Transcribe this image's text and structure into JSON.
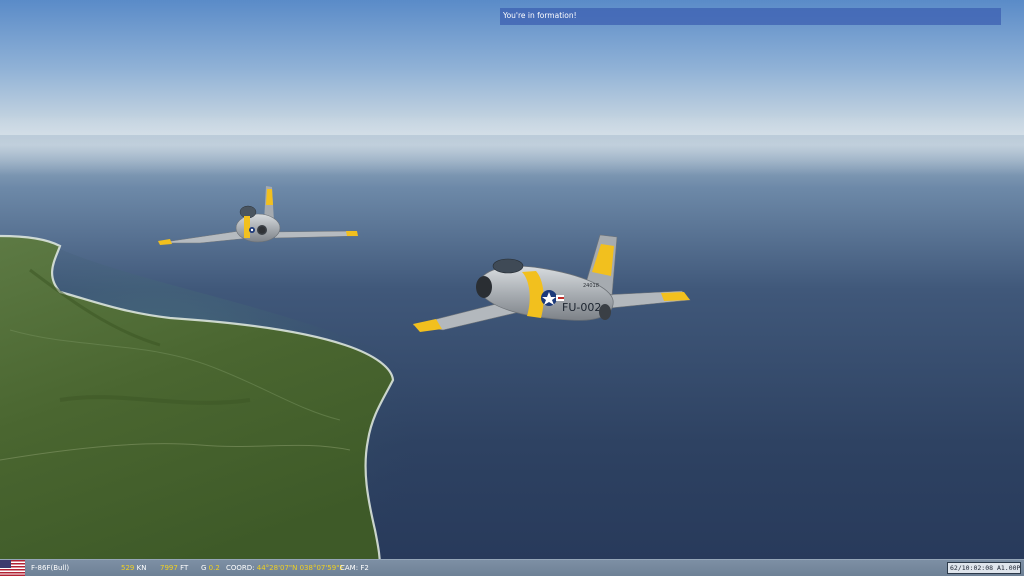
{
  "hud": {
    "message": "You're in formation!"
  },
  "status_bar": {
    "country_flag": "us-flag-icon",
    "aircraft": "F-86F(Bull)",
    "speed_value": "529",
    "speed_unit": "KN",
    "altitude_value": "7997",
    "altitude_unit": "FT",
    "g_label": "G",
    "g_value": "0.2",
    "coord_label": "COORD:",
    "coord_value": "44°28'07\"N 038°07'59\"E",
    "cam_label": "CAM:",
    "cam_value": "F2",
    "time": "62/10:02:08 A1.00P"
  },
  "scene": {
    "aircraft_markings": [
      {
        "name": "wingman-jet",
        "code": ""
      },
      {
        "name": "lead-jet",
        "code": "FU-002"
      }
    ],
    "colors": {
      "sky_top": "#5f8ec8",
      "horizon": "#c9d9e4",
      "sea": "#2a3d5c",
      "land": "#4c6a2e",
      "yellow_band": "#f2c01e"
    }
  }
}
